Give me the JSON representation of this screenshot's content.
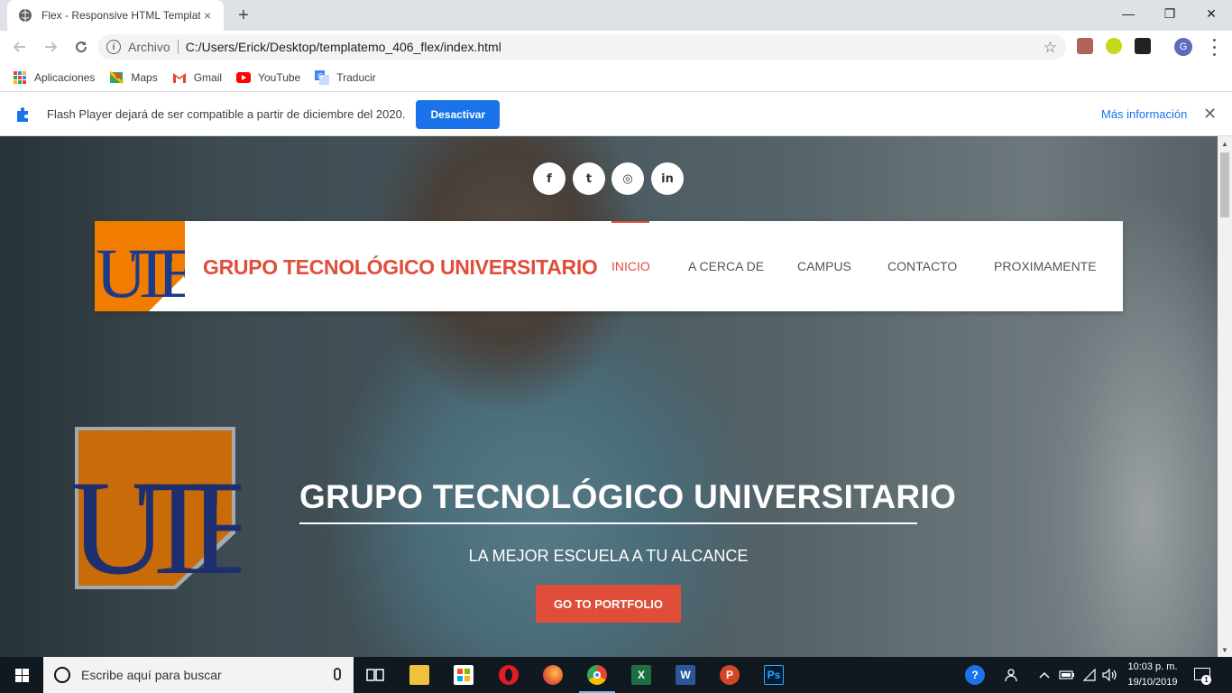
{
  "browser": {
    "tab_title": "Flex - Responsive HTML Template",
    "new_tab": "+",
    "close_tab": "×",
    "window": {
      "minimize": "—",
      "maximize": "❐",
      "close": "✕"
    },
    "address": {
      "scheme_label": "Archivo",
      "url": "C:/Users/Erick/Desktop/templatemo_406_flex/index.html"
    },
    "profile_initial": "G"
  },
  "bookmarks": [
    {
      "label": "Aplicaciones",
      "icon": "apps-grid-icon"
    },
    {
      "label": "Maps",
      "icon": "maps-icon"
    },
    {
      "label": "Gmail",
      "icon": "gmail-icon"
    },
    {
      "label": "YouTube",
      "icon": "youtube-icon"
    },
    {
      "label": "Traducir",
      "icon": "translate-icon"
    }
  ],
  "infobar": {
    "message": "Flash Player dejará de ser compatible a partir de diciembre del 2020.",
    "button": "Desactivar",
    "link": "Más información",
    "close": "✕"
  },
  "page": {
    "social": [
      {
        "name": "facebook",
        "glyph": "f"
      },
      {
        "name": "twitter",
        "glyph": "t"
      },
      {
        "name": "dribbble",
        "glyph": "◎"
      },
      {
        "name": "linkedin",
        "glyph": "in"
      }
    ],
    "site_name": "GRUPO TECNOLÓGICO UNIVERSITARIO",
    "menu": [
      "INICIO",
      "A CERCA DE",
      "CAMPUS",
      "CONTACTO",
      "PROXIMAMENTE"
    ],
    "active_menu": "INICIO",
    "hero": {
      "title": "GRUPO TECNOLÓGICO UNIVERSITARIO",
      "subtitle": "LA MEJOR ESCUELA A TU ALCANCE",
      "cta": "GO TO PORTFOLIO"
    },
    "logo_letters": "UTE"
  },
  "taskbar": {
    "search_placeholder": "Escribe aquí para buscar",
    "apps": [
      "task-view",
      "file-explorer",
      "store",
      "opera",
      "firefox",
      "chrome",
      "excel",
      "word",
      "powerpoint",
      "photoshop"
    ],
    "time": "10:03 p. m.",
    "date": "19/10/2019",
    "notifications": "1"
  },
  "colors": {
    "accent": "#e04e3a",
    "logo_orange": "#f07d00",
    "logo_blue": "#1d3a8a",
    "chrome_blue": "#1a73e8"
  }
}
